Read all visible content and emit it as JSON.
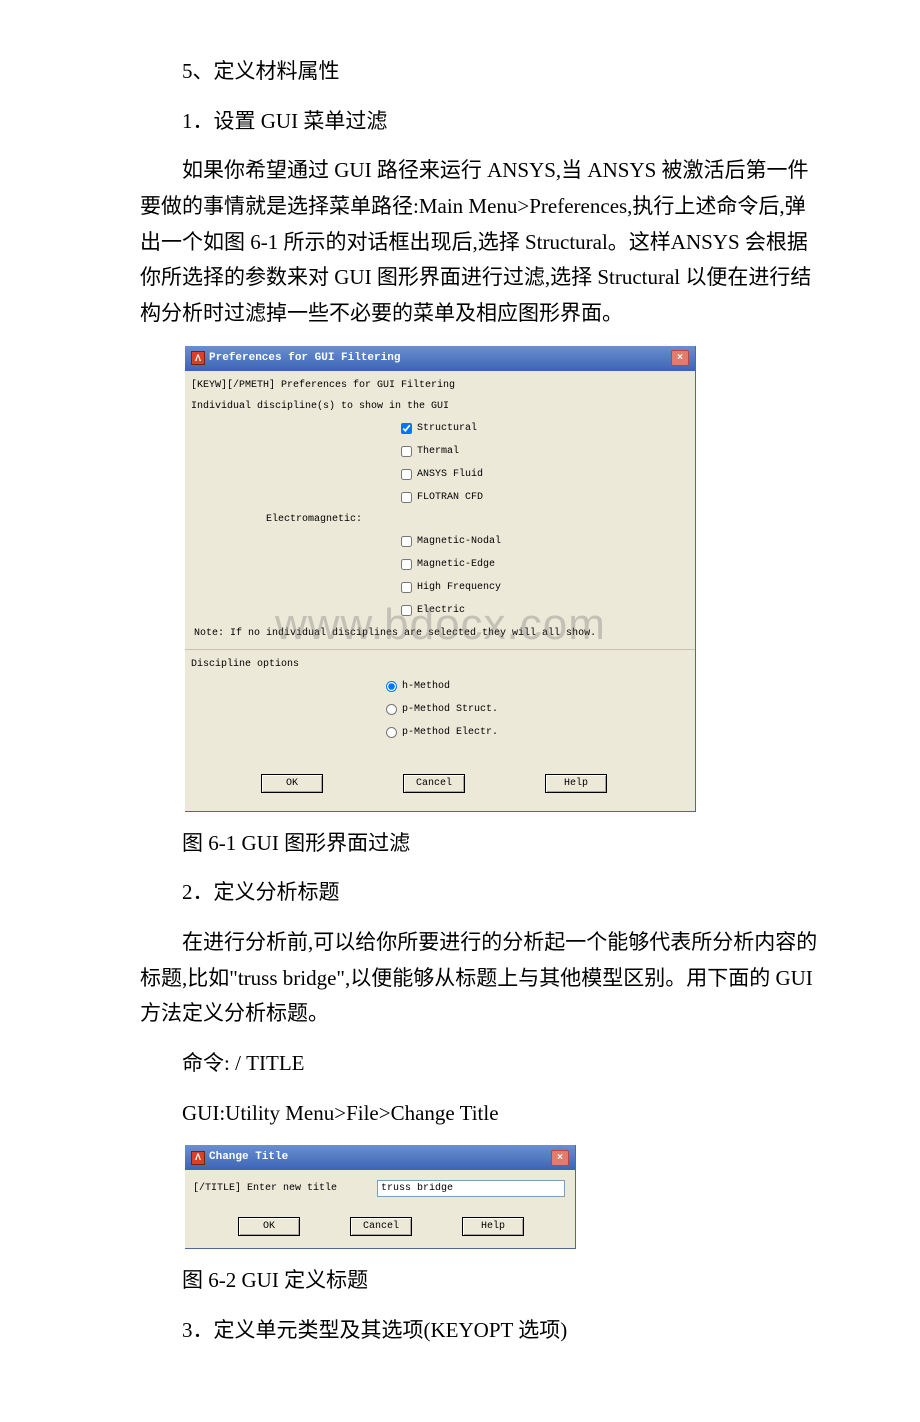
{
  "body": {
    "p1": "5、定义材料属性",
    "p2": "1．设置 GUI 菜单过滤",
    "p3": "如果你希望通过 GUI 路径来运行 ANSYS,当 ANSYS 被激活后第一件要做的事情就是选择菜单路径:Main Menu>Preferences,执行上述命令后,弹出一个如图 6-1 所示的对话框出现后,选择 Structural。这样ANSYS 会根据你所选择的参数来对 GUI 图形界面进行过滤,选择 Structural 以便在进行结构分析时过滤掉一些不必要的菜单及相应图形界面。",
    "cap1": "图 6-1 GUI 图形界面过滤",
    "p4": "2．定义分析标题",
    "p5": "在进行分析前,可以给你所要进行的分析起一个能够代表所分析内容的标题,比如\"truss bridge\",以便能够从标题上与其他模型区别。用下面的 GUI 方法定义分析标题。",
    "p6": "命令: / TITLE",
    "p7": "GUI:Utility Menu>File>Change Title",
    "cap2": "图 6-2 GUI 定义标题",
    "p8": "3．定义单元类型及其选项(KEYOPT 选项)"
  },
  "dlg1": {
    "title": "Preferences for GUI Filtering",
    "a": "Λ",
    "line1": "[KEYW][/PMETH] Preferences for GUI Filtering",
    "line2": "Individual discipline(s) to show in the GUI",
    "opts": {
      "struct": "Structural",
      "thermal": "Thermal",
      "fluid": "ANSYS Fluid",
      "flotran": "FLOTRAN CFD",
      "emlabel": "Electromagnetic:",
      "magnodal": "Magnetic-Nodal",
      "magedge": "Magnetic-Edge",
      "highfreq": "High Frequency",
      "electric": "Electric"
    },
    "note": "Note: If no individual disciplines are selected they will all show.",
    "doptlabel": "Discipline options",
    "radios": {
      "h": "h-Method",
      "ps": "p-Method Struct.",
      "pe": "p-Method Electr."
    },
    "btns": {
      "ok": "OK",
      "cancel": "Cancel",
      "help": "Help"
    }
  },
  "dlg2": {
    "title": "Change Title",
    "a": "Λ",
    "prompt": "[/TITLE]  Enter new title",
    "value": "truss bridge",
    "btns": {
      "ok": "OK",
      "cancel": "Cancel",
      "help": "Help"
    }
  },
  "watermark": "www.bdocx.com"
}
